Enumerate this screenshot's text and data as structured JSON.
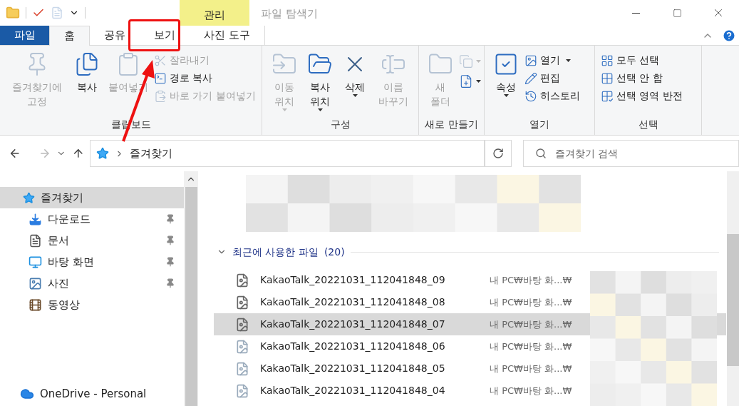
{
  "window": {
    "title": "파일 탐색기",
    "context_tab": "관리"
  },
  "tabs": [
    {
      "label": "파일",
      "kind": "file",
      "selected": false
    },
    {
      "label": "홈",
      "kind": "tab",
      "selected": true
    },
    {
      "label": "공유",
      "kind": "tab",
      "selected": false
    },
    {
      "label": "보기",
      "kind": "tab",
      "selected": false
    },
    {
      "label": "사진 도구",
      "kind": "tab",
      "selected": false
    }
  ],
  "ribbon": {
    "groups": [
      {
        "label": "클립보드",
        "items": [
          {
            "label": "즐겨찾기에 고정",
            "kind": "large",
            "disabled": true,
            "dropdown": false
          },
          {
            "label": "복사",
            "kind": "large",
            "disabled": false,
            "dropdown": false
          },
          {
            "label": "붙여넣기",
            "kind": "large",
            "disabled": true,
            "dropdown": false
          },
          {
            "label": "잘라내기",
            "kind": "small",
            "disabled": true,
            "dropdown": false
          },
          {
            "label": "경로 복사",
            "kind": "small",
            "disabled": false,
            "dropdown": false
          },
          {
            "label": "바로 가기 붙여넣기",
            "kind": "small",
            "disabled": true,
            "dropdown": false
          }
        ]
      },
      {
        "label": "구성",
        "items": [
          {
            "label": "이동 위치",
            "kind": "large",
            "disabled": true,
            "dropdown": true
          },
          {
            "label": "복사 위치",
            "kind": "large",
            "disabled": false,
            "dropdown": true
          },
          {
            "label": "삭제",
            "kind": "large",
            "disabled": false,
            "dropdown": true
          },
          {
            "label": "이름 바꾸기",
            "kind": "large",
            "disabled": true,
            "dropdown": false
          }
        ]
      },
      {
        "label": "새로 만들기",
        "items": [
          {
            "label": "새 폴더",
            "kind": "large",
            "disabled": true,
            "dropdown": false
          },
          {
            "kind": "icon",
            "disabled": true,
            "dropdown": true
          },
          {
            "kind": "icon",
            "disabled": false,
            "dropdown": true
          }
        ]
      },
      {
        "label": "열기",
        "items": [
          {
            "label": "속성",
            "kind": "large",
            "disabled": false,
            "dropdown": true
          },
          {
            "label": "열기",
            "kind": "small",
            "disabled": false,
            "dropdown": true
          },
          {
            "label": "편집",
            "kind": "small",
            "disabled": false,
            "dropdown": false
          },
          {
            "label": "히스토리",
            "kind": "small",
            "disabled": false,
            "dropdown": false
          }
        ]
      },
      {
        "label": "선택",
        "items": [
          {
            "label": "모두 선택",
            "kind": "small",
            "disabled": false,
            "dropdown": false
          },
          {
            "label": "선택 안 함",
            "kind": "small",
            "disabled": false,
            "dropdown": false
          },
          {
            "label": "선택 영역 반전",
            "kind": "small",
            "disabled": false,
            "dropdown": false
          }
        ]
      }
    ]
  },
  "address": {
    "path": "즐겨찾기"
  },
  "search": {
    "placeholder": "즐겨찾기 검색"
  },
  "sidebar": {
    "items": [
      {
        "label": "즐겨찾기",
        "selected": true,
        "children": [
          {
            "label": "다운로드",
            "pinned": true,
            "selected": false
          },
          {
            "label": "문서",
            "pinned": true,
            "selected": false
          },
          {
            "label": "바탕 화면",
            "pinned": true,
            "selected": false
          },
          {
            "label": "사진",
            "pinned": true,
            "selected": false
          },
          {
            "label": "동영상",
            "pinned": false,
            "selected": false
          }
        ]
      },
      {
        "label": "OneDrive - Personal",
        "selected": false
      }
    ]
  },
  "recent": {
    "title": "최근에 사용한 파일",
    "count": "(20)",
    "expanded": true,
    "files": [
      {
        "name": "KakaoTalk_20221031_112041848_09",
        "location": "내 PC₩바탕 화...₩",
        "selected": false
      },
      {
        "name": "KakaoTalk_20221031_112041848_08",
        "location": "내 PC₩바탕 화...₩",
        "selected": false
      },
      {
        "name": "KakaoTalk_20221031_112041848_07",
        "location": "내 PC₩바탕 화...₩",
        "selected": true
      },
      {
        "name": "KakaoTalk_20221031_112041848_06",
        "location": "내 PC₩바탕 화...₩",
        "selected": false
      },
      {
        "name": "KakaoTalk_20221031_112041848_05",
        "location": "내 PC₩바탕 화...₩",
        "selected": false
      },
      {
        "name": "KakaoTalk_20221031_112041848_04",
        "location": "내 PC₩바탕 화...₩",
        "selected": false
      }
    ]
  }
}
